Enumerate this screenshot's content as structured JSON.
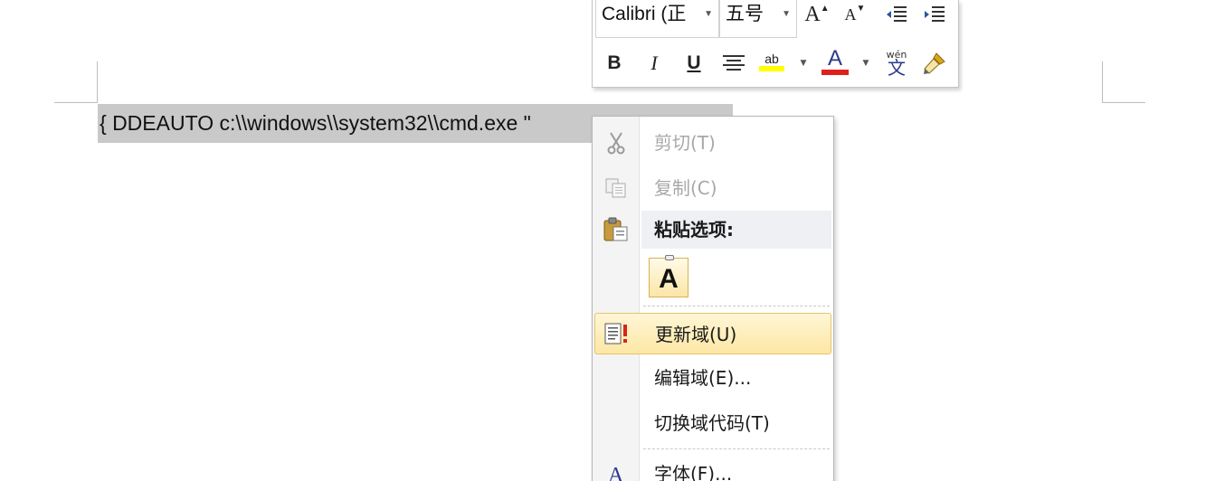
{
  "document": {
    "field_code_text": "{  DDEAUTO c:\\\\windows\\\\system32\\\\cmd.exe  \""
  },
  "mini_toolbar": {
    "font_name": "Calibri (正",
    "font_size": "五号",
    "grow_font_label": "A",
    "shrink_font_label": "A",
    "bold_label": "B",
    "italic_label": "I",
    "underline_label": "U",
    "font_color_label": "A",
    "phonetic_label": "wén",
    "phonetic_char": "文",
    "highlight_label": "ab",
    "highlight_color": "#ffff00",
    "font_color": "#e0201c"
  },
  "context_menu": {
    "items": [
      {
        "label": "剪切(T)",
        "icon": "scissors-icon",
        "enabled": false
      },
      {
        "label": "复制(C)",
        "icon": "copy-icon",
        "enabled": false
      },
      {
        "label": "粘贴选项:",
        "icon": "paste-icon",
        "enabled": true
      },
      {
        "label": "更新域(U)",
        "icon": "update-field-icon",
        "enabled": true
      },
      {
        "label": "编辑域(E)...",
        "icon": "",
        "enabled": true
      },
      {
        "label": "切换域代码(T)",
        "icon": "",
        "enabled": true
      },
      {
        "label": "字体(F)...",
        "icon": "font-icon",
        "enabled": true
      }
    ],
    "paste_keep_text_label": "A"
  }
}
